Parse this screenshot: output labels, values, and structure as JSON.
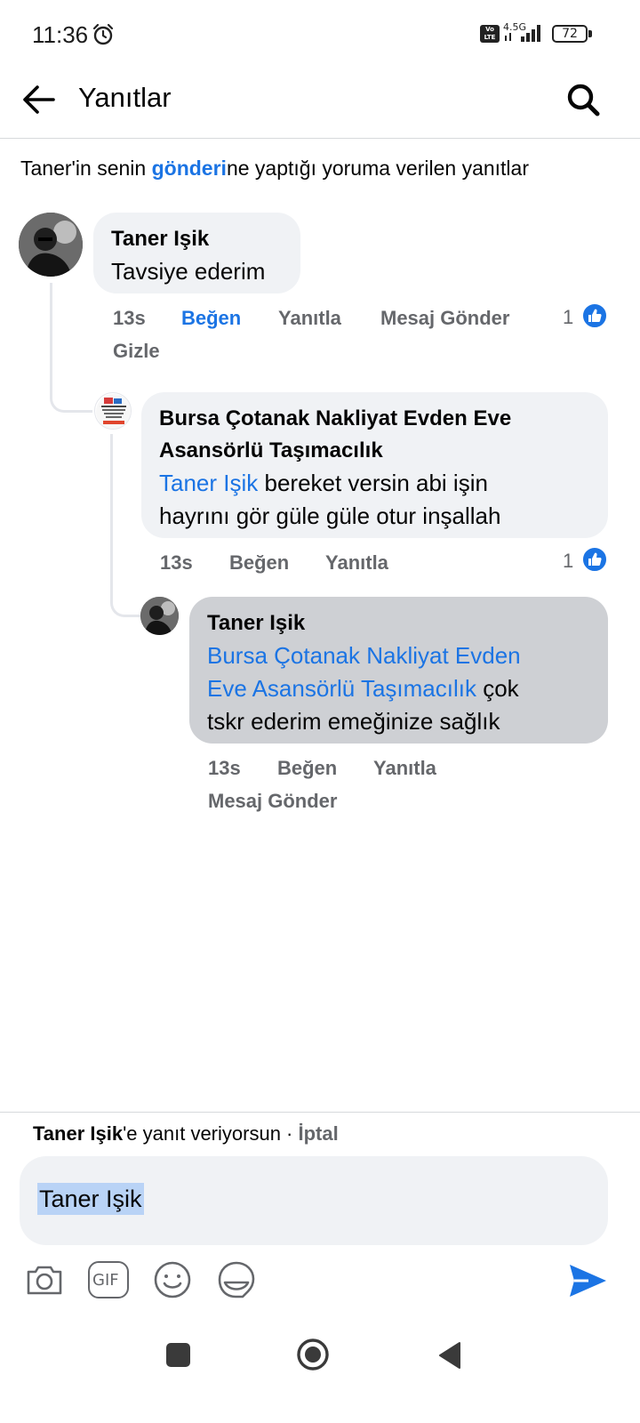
{
  "status_bar": {
    "time": "11:36",
    "volte_label": "Vo LTE",
    "network_label": "4.5G",
    "battery": "72",
    "icons": [
      "alarm-icon",
      "volte-icon",
      "signal-icon",
      "battery-icon"
    ]
  },
  "header": {
    "title": "Yanıtlar",
    "back_icon": "arrow-left-icon",
    "search_icon": "search-icon"
  },
  "context": {
    "prefix": "Taner'in senin ",
    "link": "gönderi",
    "suffix": "ne yaptığı yoruma verilen yanıtlar"
  },
  "comments": [
    {
      "author": "Taner Işik",
      "text": "Tavsiye ederim",
      "time": "13s",
      "like_label": "Beğen",
      "reply_label": "Yanıtla",
      "message_label": "Mesaj Gönder",
      "hide_label": "Gizle",
      "reaction_count": "1",
      "liked": true
    },
    {
      "author": "Bursa Çotanak Nakliyat Evden Eve Asansörlü Taşımacılık",
      "author_line1": "Bursa Çotanak Nakliyat Evden Eve",
      "author_line2": "Asansörlü Taşımacılık",
      "mention": "Taner Işik",
      "text_line1": " bereket versin abi işin",
      "text_line2": "hayrını gör güle güle otur inşallah",
      "time": "13s",
      "like_label": "Beğen",
      "reply_label": "Yanıtla",
      "reaction_count": "1",
      "liked": false
    },
    {
      "author": "Taner Işik",
      "mention_line1": "Bursa Çotanak Nakliyat Evden",
      "mention_line2": "Eve Asansörlü Taşımacılık",
      "text_line2_suffix": " çok",
      "text_line3": "tskr ederim emeğinize sağlık",
      "time": "13s",
      "like_label": "Beğen",
      "reply_label": "Yanıtla",
      "message_label": "Mesaj Gönder",
      "liked": false
    }
  ],
  "composer": {
    "replying_name": "Taner Işik",
    "replying_suffix": "'e yanıt veriyorsun · ",
    "cancel_label": "İptal",
    "input_value": "Taner Işik",
    "tools": [
      "camera-icon",
      "gif-icon",
      "emoji-icon",
      "sticker-icon"
    ],
    "gif_label": "GIF",
    "send_icon": "send-icon"
  },
  "nav": [
    "recent-apps-button",
    "home-button",
    "back-nav-button"
  ],
  "colors": {
    "accent": "#1b74e4",
    "bubble": "#f0f2f5",
    "bubble_selected": "#ced0d4",
    "secondary_text": "#65676b"
  }
}
